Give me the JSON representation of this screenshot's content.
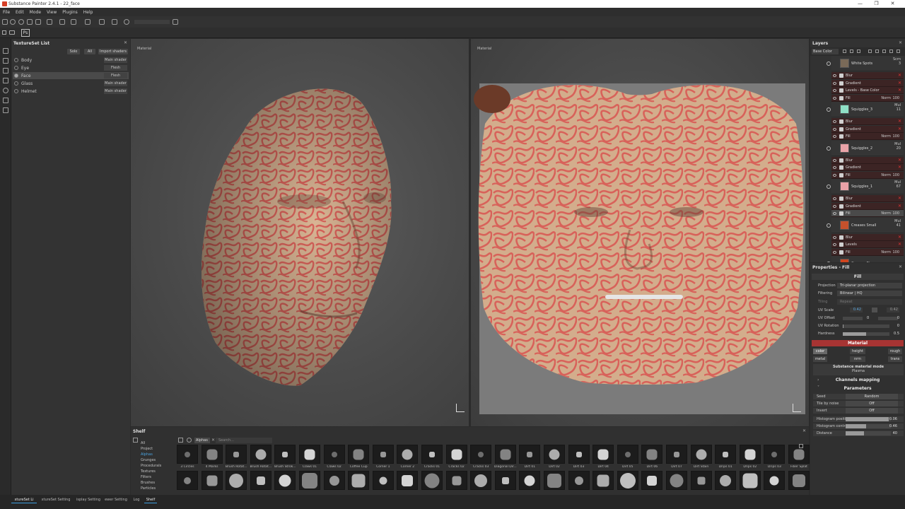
{
  "window": {
    "title": "Substance Painter 2.4.1 - 22_face",
    "controls": [
      "—",
      "❐",
      "✕"
    ]
  },
  "menu": [
    "File",
    "Edit",
    "Mode",
    "View",
    "Plugins",
    "Help"
  ],
  "toolbar": {
    "ps_label": "Ps"
  },
  "texture_set_list": {
    "title": "TextureSet List",
    "buttons": {
      "solo": "Solo",
      "all": "All",
      "import": "Import shaders"
    },
    "items": [
      {
        "name": "Body",
        "shader": "Main shader"
      },
      {
        "name": "Eye",
        "shader": "Flesh"
      },
      {
        "name": "Face",
        "shader": "Flesh",
        "selected": true
      },
      {
        "name": "Glass",
        "shader": "Main shader"
      },
      {
        "name": "Helmet",
        "shader": "Main shader"
      }
    ]
  },
  "viewports": {
    "left_label": "Material",
    "right_label": "Material"
  },
  "layers": {
    "title": "Layers",
    "channel": "Base Color",
    "rows": [
      {
        "kind": "group",
        "name": "White Spots",
        "blend": "Scrn",
        "opacity": "3",
        "thumb": "#7a6a58"
      },
      {
        "kind": "sub",
        "name": "Blur",
        "icon": "filter"
      },
      {
        "kind": "sub",
        "name": "Gradient",
        "icon": "filter"
      },
      {
        "kind": "sub",
        "name": "Levels - Base Color",
        "icon": "levels"
      },
      {
        "kind": "sub",
        "name": "Fill",
        "icon": "fill",
        "blend": "Norm",
        "opacity": "100"
      },
      {
        "kind": "group",
        "name": "Squiggles_3",
        "blend": "Mul",
        "opacity": "11",
        "thumb": "#8fe0c6"
      },
      {
        "kind": "sub",
        "name": "Blur",
        "icon": "filter"
      },
      {
        "kind": "sub",
        "name": "Gradient",
        "icon": "filter"
      },
      {
        "kind": "sub",
        "name": "Fill",
        "icon": "fill",
        "blend": "Norm",
        "opacity": "100"
      },
      {
        "kind": "group",
        "name": "Squiggles_2",
        "blend": "Mul",
        "opacity": "20",
        "thumb": "#e9a3a8"
      },
      {
        "kind": "sub",
        "name": "Blur",
        "icon": "filter"
      },
      {
        "kind": "sub",
        "name": "Gradient",
        "icon": "filter"
      },
      {
        "kind": "sub",
        "name": "Fill",
        "icon": "fill",
        "blend": "Norm",
        "opacity": "100"
      },
      {
        "kind": "group",
        "name": "Squiggles_1",
        "blend": "Mul",
        "opacity": "67",
        "thumb": "#e8a1a8"
      },
      {
        "kind": "sub",
        "name": "Blur",
        "icon": "filter"
      },
      {
        "kind": "sub",
        "name": "Gradient",
        "icon": "filter"
      },
      {
        "kind": "sub",
        "name": "Fill",
        "icon": "fill",
        "blend": "Norm",
        "opacity": "100",
        "selected": true
      },
      {
        "kind": "group",
        "name": "Creases Small",
        "blend": "Mul",
        "opacity": "41",
        "thumb": "#c4512c"
      },
      {
        "kind": "sub",
        "name": "Blur",
        "icon": "filter"
      },
      {
        "kind": "sub",
        "name": "Levels",
        "icon": "levels"
      },
      {
        "kind": "sub",
        "name": "Fill",
        "icon": "fill",
        "blend": "Norm",
        "opacity": "100"
      },
      {
        "kind": "group",
        "name": "Creases Big",
        "blend": "",
        "opacity": "",
        "thumb": "#d0451f"
      }
    ]
  },
  "properties": {
    "title": "Properties - Fill",
    "fill_section": "Fill",
    "projection_label": "Projection",
    "projection_value": "Tri-planar projection",
    "filtering_label": "Filtering",
    "filtering_value": "Bilinear | HQ",
    "tiling_label": "Tiling",
    "tiling_value": "Repeat",
    "uv_scale_label": "UV Scale",
    "uv_scale_value": "0.42",
    "uv_offset_label": "UV Offset",
    "uv_offset_value": "0",
    "uv_offset_value2": "0",
    "uv_rotation_label": "UV Rotation",
    "uv_rotation_value": "0",
    "hardness_label": "Hardness",
    "hardness_value": "0.5",
    "hardness_fill": 0.5,
    "material_section": "Material",
    "channels": [
      "color",
      "height",
      "rough",
      "metal",
      "nrm",
      "trans"
    ],
    "substance_mode_title": "Substance material mode",
    "substance_mode_value": "Plasma",
    "channels_mapping": "Channels mapping",
    "parameters": "Parameters",
    "params": [
      {
        "label": "Seed",
        "button": "Random"
      },
      {
        "label": "Tile by noise",
        "button": "Off"
      },
      {
        "label": "Invert",
        "button": "Off"
      }
    ],
    "sliders": [
      {
        "label": "Histogram position",
        "value": "0.06",
        "fill": 0.96
      },
      {
        "label": "Histogram contrast",
        "value": "0.46",
        "fill": 0.46
      },
      {
        "label": "Distance",
        "value": "40",
        "fill": 0.4
      }
    ]
  },
  "shelf": {
    "title": "Shelf",
    "filter_tag": "Alphas",
    "search_placeholder": "Search...",
    "categories": [
      "All",
      "Project",
      "Alphas",
      "Grunges",
      "Procedurals",
      "Textures",
      "Filters",
      "Brushes",
      "Particles"
    ],
    "row1": [
      "3 Circles",
      "4 Marks",
      "Brush Rotat...",
      "Brush Rotat...",
      "Brush Strok...",
      "Claws 01",
      "Claws 02",
      "Coffee Cup",
      "Corner 1",
      "Corner 2",
      "Cracks 01",
      "Cracks 02",
      "Cracks 03",
      "Diagonal Dir...",
      "Dirt 01",
      "Dirt 02",
      "Dirt 03",
      "Dirt 04",
      "Dirt 05",
      "Dirt 06",
      "Dirt 07",
      "Dirt Stain",
      "Drips 01",
      "Drips 02",
      "Drips 03",
      "Fiber Splat"
    ]
  },
  "bottom_tabs": [
    "xtureSet Li",
    "xtureSet Setting",
    "isplay Setting",
    "ewer Setting",
    "Log",
    "Shelf"
  ]
}
